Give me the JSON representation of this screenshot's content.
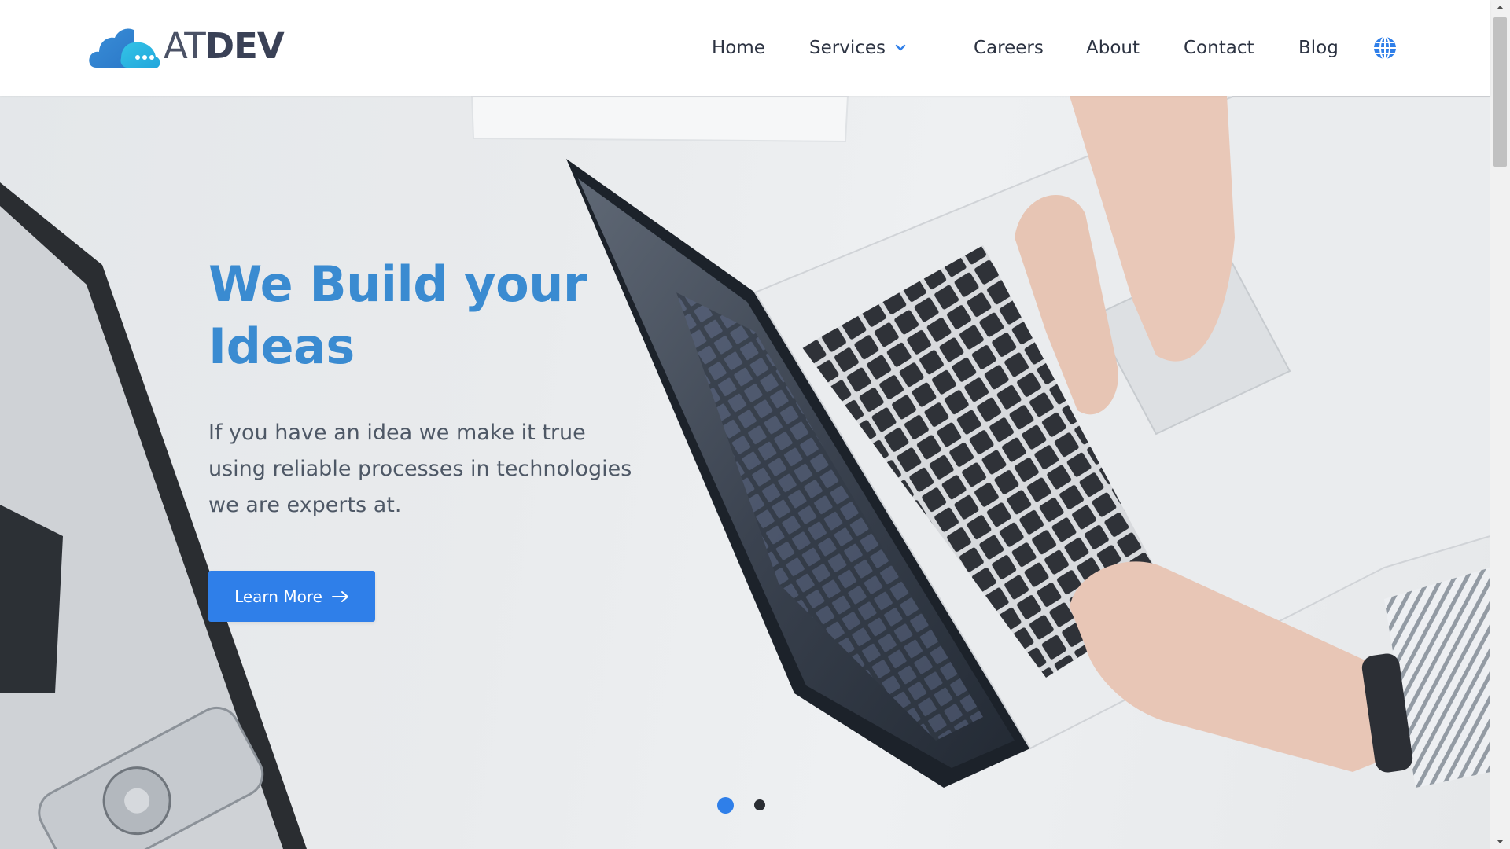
{
  "brand": {
    "logo_at": "AT",
    "logo_dev": "DEV",
    "primary_color": "#2f7fe9",
    "title_color": "#3a8bd1"
  },
  "nav": {
    "home": "Home",
    "services": "Services",
    "careers": "Careers",
    "about": "About",
    "contact": "Contact",
    "blog": "Blog",
    "language_icon": "globe-icon"
  },
  "hero": {
    "title_line1": "We Build your",
    "title_line2": "Ideas",
    "description": "If you have an idea we make it true using reliable processes in technologies we are experts at.",
    "cta_label": "Learn More",
    "cta_icon": "arrow-right-icon",
    "slides_total": 2,
    "slide_active": 1
  }
}
